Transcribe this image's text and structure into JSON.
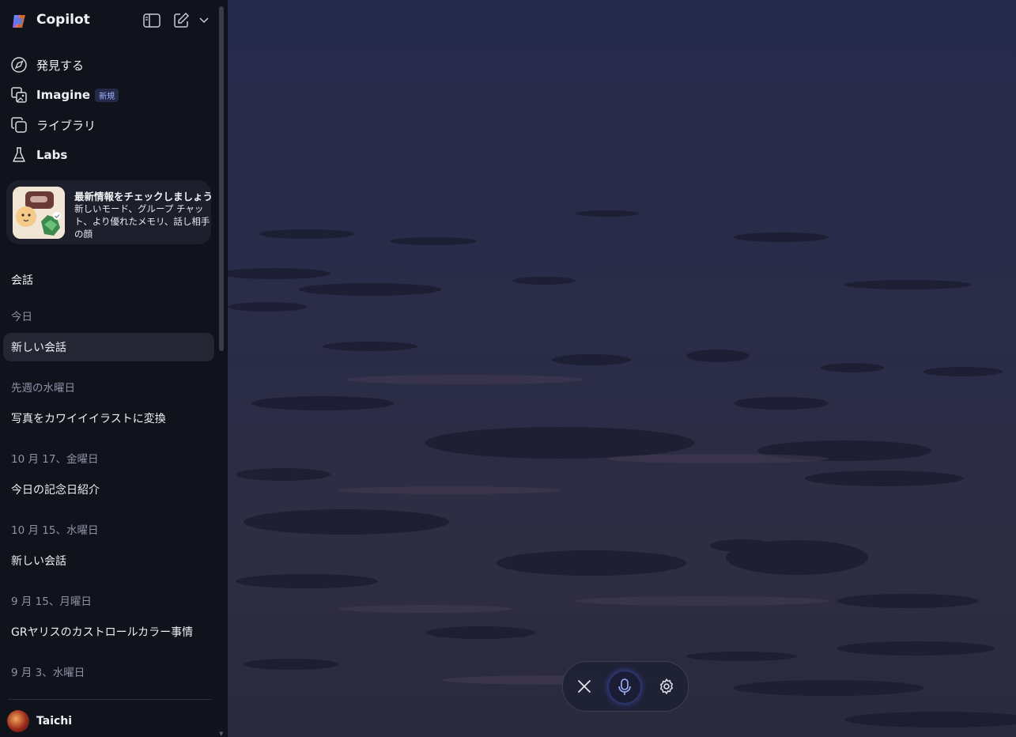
{
  "app": {
    "title": "Copilot"
  },
  "nav": [
    {
      "label": "発見する",
      "icon": "compass-icon"
    },
    {
      "label": "Imagine",
      "icon": "image-gallery-icon",
      "badge": "新規"
    },
    {
      "label": "ライブラリ",
      "icon": "library-icon"
    },
    {
      "label": "Labs",
      "icon": "flask-icon"
    }
  ],
  "promo": {
    "title": "最新情報をチェックしましょう",
    "description": "新しいモード、グループ チャット、より優れたメモリ、話し相手の顔"
  },
  "conversations": {
    "section_title": "会話",
    "groups": [
      {
        "label": "今日",
        "items": [
          "新しい会話"
        ]
      },
      {
        "label": "先週の水曜日",
        "items": [
          "写真をカワイイイラストに変換"
        ]
      },
      {
        "label": "10 月 17、金曜日",
        "items": [
          "今日の記念日紹介"
        ]
      },
      {
        "label": "10 月 15、水曜日",
        "items": [
          "新しい会話"
        ]
      },
      {
        "label": "9 月 15、月曜日",
        "items": [
          "GRヤリスのカストロールカラー事情"
        ]
      },
      {
        "label": "9 月 3、水曜日",
        "items": []
      }
    ]
  },
  "user": {
    "name": "Taichi"
  },
  "voice_controls": {
    "close_icon": "close-icon",
    "mic_icon": "microphone-icon",
    "settings_icon": "gear-icon"
  },
  "colors": {
    "sidebar_bg": "#10121c",
    "active_item": "#242733",
    "accent": "#7f90ff"
  }
}
